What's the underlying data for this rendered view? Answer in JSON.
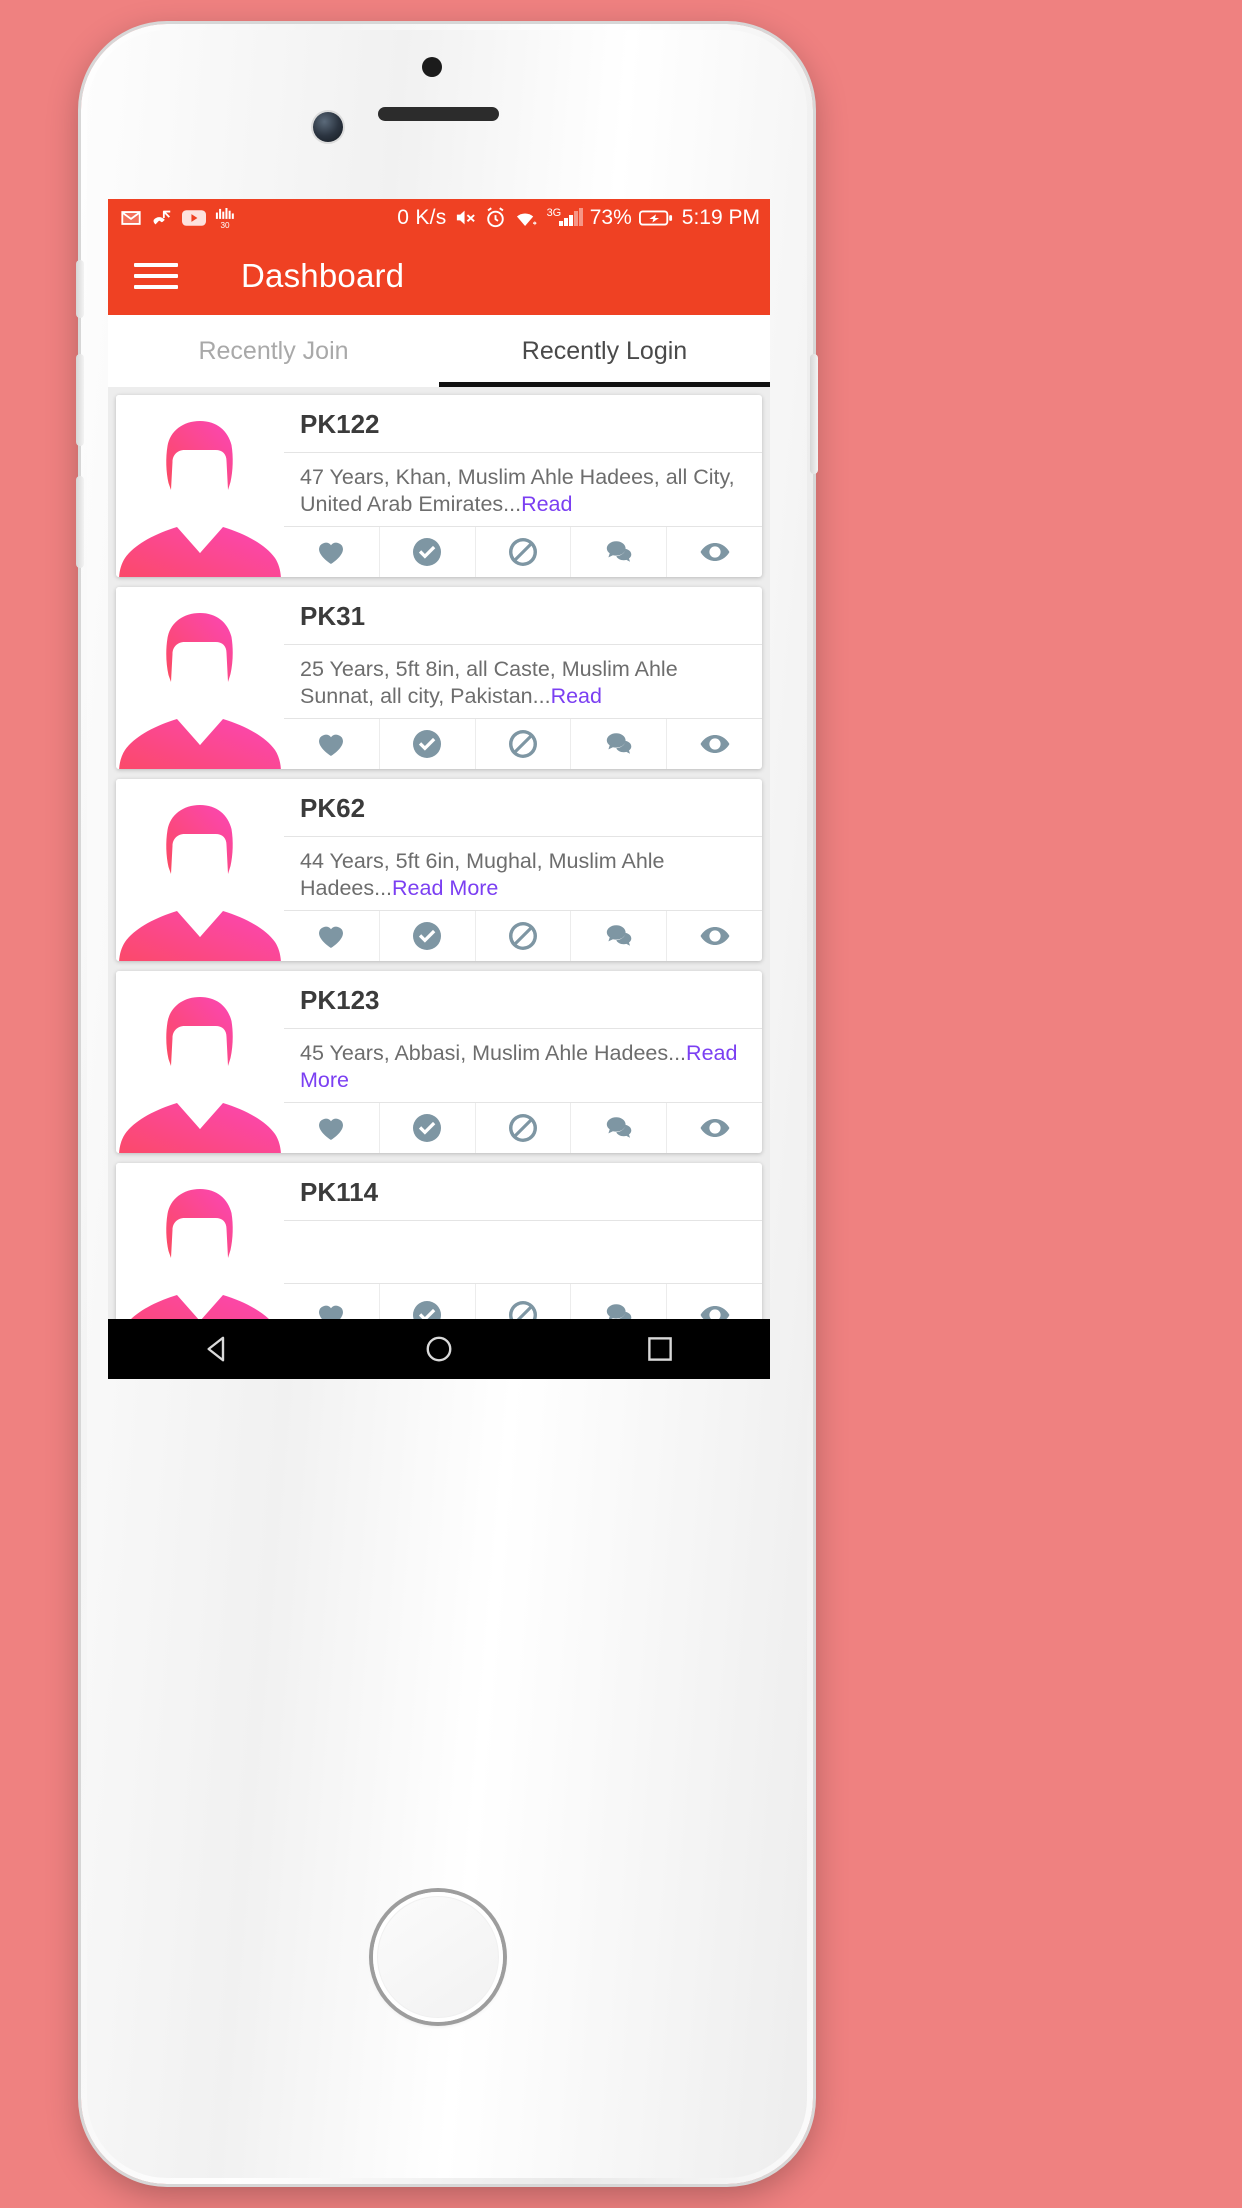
{
  "theme": {
    "background": "#ef8180",
    "primary": "#ef4123",
    "accent_link": "#7b3ff2",
    "action_icon": "#7e96a3",
    "avatar_gradient_from": "#fb4a5e",
    "avatar_gradient_to": "#fb46b6"
  },
  "status_bar": {
    "left_icons": [
      "mail-icon",
      "missed-call-icon",
      "youtube-icon",
      "equalizer-icon"
    ],
    "net_speed": "0 K/s",
    "right_icons": [
      "mute-icon",
      "alarm-icon",
      "wifi-icon"
    ],
    "signal_generation": "3G",
    "signal_icon": "cell-signal-icon",
    "battery_percent": "73%",
    "battery_icon": "battery-charging-icon",
    "clock": "5:19 PM"
  },
  "app_bar": {
    "menu_icon": "hamburger-menu-icon",
    "title": "Dashboard"
  },
  "tabs": [
    {
      "label": "Recently Join",
      "active": false
    },
    {
      "label": "Recently Login",
      "active": true
    }
  ],
  "actions": [
    {
      "name": "favorite-button",
      "icon": "heart-icon"
    },
    {
      "name": "accept-button",
      "icon": "check-circle-icon"
    },
    {
      "name": "block-button",
      "icon": "block-icon"
    },
    {
      "name": "chat-button",
      "icon": "chat-bubbles-icon"
    },
    {
      "name": "view-button",
      "icon": "eye-icon"
    }
  ],
  "cards": [
    {
      "id": "PK122",
      "description": "47 Years, Khan, Muslim Ahle Hadees, all City, United Arab Emirates...",
      "read_more": "Read",
      "avatar": "male-placeholder-avatar"
    },
    {
      "id": "PK31",
      "description": "25 Years, 5ft 8in, all Caste, Muslim Ahle Sunnat, all city, Pakistan...",
      "read_more": "Read",
      "avatar": "male-placeholder-avatar"
    },
    {
      "id": "PK62",
      "description": "44 Years, 5ft 6in, Mughal, Muslim Ahle Hadees...",
      "read_more": "Read More",
      "avatar": "male-placeholder-avatar"
    },
    {
      "id": "PK123",
      "description": "45 Years, Abbasi, Muslim Ahle Hadees...",
      "read_more": "Read More",
      "avatar": "male-placeholder-avatar"
    },
    {
      "id": "PK114",
      "description": "",
      "read_more": "",
      "avatar": "male-placeholder-avatar"
    }
  ],
  "nav_bar": [
    {
      "name": "back-button",
      "icon": "triangle-back-icon"
    },
    {
      "name": "home-button",
      "icon": "circle-home-icon"
    },
    {
      "name": "recents-button",
      "icon": "square-recents-icon"
    }
  ]
}
